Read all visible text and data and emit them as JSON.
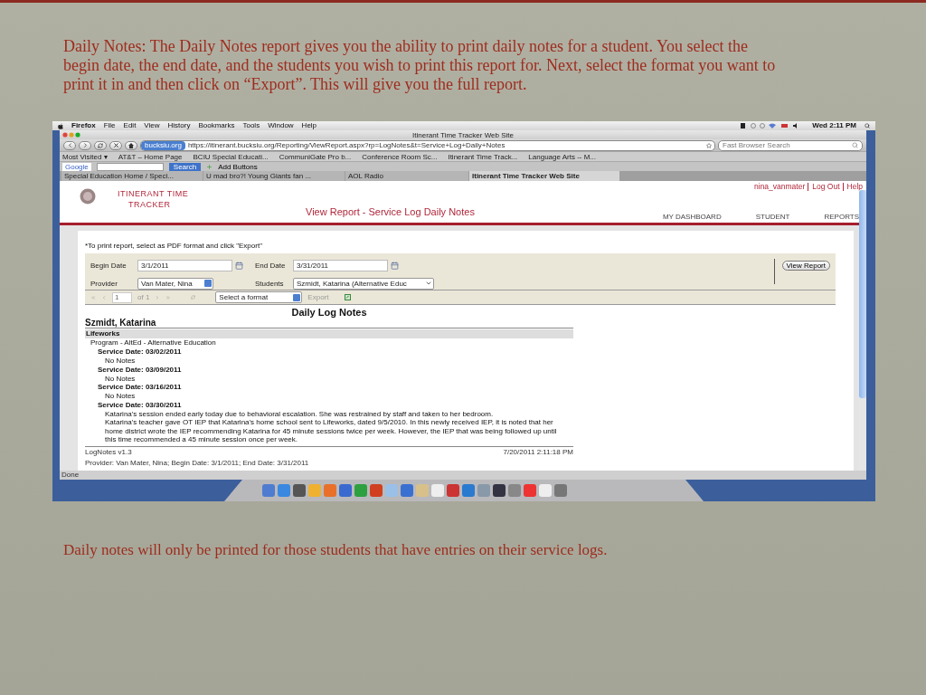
{
  "slide": {
    "intro_text": "Daily Notes:  The Daily Notes report gives you the ability to print daily notes for a student. You select the begin date, the end date, and the students you wish to print this report for. Next, select the format you want to print it in and then click on “Export”.  This will give you the full report.",
    "footer_text": "Daily notes will only be printed for those students that have entries on their service logs."
  },
  "menu_bar": {
    "app": "Firefox",
    "items": [
      "File",
      "Edit",
      "View",
      "History",
      "Bookmarks",
      "Tools",
      "Window",
      "Help"
    ],
    "clock": "Wed 2:11 PM"
  },
  "browser": {
    "title": "Itinerant Time Tracker Web Site",
    "site_badge": "bucksiu.org",
    "url": "https://itinerant.bucksiu.org/Reporting/ViewReport.aspx?rp=LogNotes&t=Service+Log+Daily+Notes",
    "search_placeholder": "Fast Browser Search",
    "bookmarks": [
      "Most Visited ▾",
      "AT&T – Home Page",
      "BCIU Special Educati...",
      "CommuniGate Pro b...",
      "Conference Room Sc...",
      "Itinerant Time Track...",
      "Language Arts -- M..."
    ],
    "google_toolbar": {
      "logo": "Google",
      "search_button": "Search",
      "add_buttons": "Add Buttons"
    },
    "tabs": [
      {
        "label": "Special Education Home / Speci...",
        "selected": false
      },
      {
        "label": "U mad bro?! Young Giants fan ...",
        "selected": false
      },
      {
        "label": "AOL Radio",
        "selected": false
      },
      {
        "label": "Itinerant Time Tracker Web Site",
        "selected": true
      }
    ],
    "status": "Done"
  },
  "page": {
    "logo_lines": [
      "ITINERANT TIME",
      "TRACKER"
    ],
    "user_links": [
      "nina_vanmater",
      "Log Out",
      "Help"
    ],
    "title": "View Report - Service Log Daily Notes",
    "nav": [
      {
        "label": "MY DASHBOARD",
        "selected": false
      },
      {
        "label": "STUDENT",
        "selected": false
      },
      {
        "label": "REPORTS",
        "selected": false
      }
    ],
    "hint": "*To print report, select as PDF format and click \"Export\"",
    "filters": {
      "begin_label": "Begin Date",
      "begin_value": "3/1/2011",
      "end_label": "End Date",
      "end_value": "3/31/2011",
      "provider_label": "Provider",
      "provider_value": "Van Mater, Nina",
      "students_label": "Students",
      "students_value": "Szmidt, Katarina  (Alternative Educ",
      "view_button": "View Report"
    },
    "report_toolbar": {
      "page": "1",
      "of": "of 1",
      "format_placeholder": "Select a format",
      "export": "Export"
    },
    "report": {
      "title": "Daily Log Notes",
      "student": "Szmidt, Katarina",
      "group": "Lifeworks",
      "program": "Program - AltEd - Alternative Education",
      "services": [
        {
          "date": "Service Date: 03/02/2011",
          "notes": [
            "No Notes"
          ]
        },
        {
          "date": "Service Date: 03/09/2011",
          "notes": [
            "No Notes"
          ]
        },
        {
          "date": "Service Date: 03/16/2011",
          "notes": [
            "No Notes"
          ]
        },
        {
          "date": "Service Date: 03/30/2011",
          "notes": [
            "Katarina's session ended early today due to behavioral escalation. She was restrained by staff and taken to her bedroom.",
            "Katarina's teacher gave OT IEP that Katarina's home school sent to Lifeworks, dated 9/5/2010. In this newly received IEP, it is noted that her home district wrote the IEP recommending Katarina for 45 minute sessions twice per week. However, the IEP that was being followed up until this time recommended a 45 minute session once per week."
          ]
        }
      ],
      "footer_left": "LogNotes v1.3",
      "footer_right": "7/20/2011 2:11:18 PM",
      "provider_line": "Provider: Van Mater, Nina; Begin Date: 3/1/2011; End Date: 3/31/2011"
    }
  }
}
